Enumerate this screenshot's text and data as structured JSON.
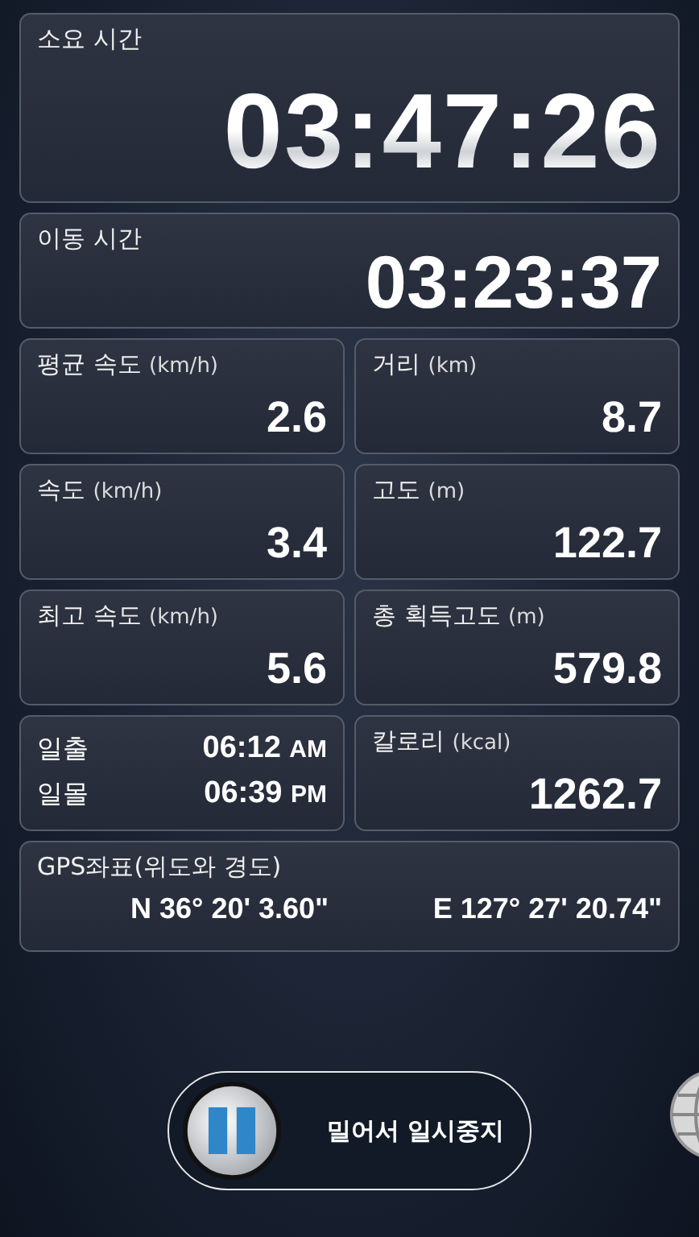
{
  "total_time": {
    "label": "소요 시간",
    "value": "03:47:26"
  },
  "moving_time": {
    "label": "이동 시간",
    "value": "03:23:37"
  },
  "tiles": [
    {
      "kind": "metric",
      "label": "평균 속도",
      "unit": "(km/h)",
      "value": "2.6"
    },
    {
      "kind": "metric",
      "label": "거리",
      "unit": "(km)",
      "value": "8.7"
    },
    {
      "kind": "metric",
      "label": "속도",
      "unit": "(km/h)",
      "value": "3.4"
    },
    {
      "kind": "metric",
      "label": "고도",
      "unit": "(m)",
      "value": "122.7"
    },
    {
      "kind": "metric",
      "label": "최고 속도",
      "unit": "(km/h)",
      "value": "5.6"
    },
    {
      "kind": "metric",
      "label": "총 획득고도",
      "unit": "(m)",
      "value": "579.8"
    },
    {
      "kind": "sun",
      "rows": [
        {
          "label": "일출",
          "time": "06:12",
          "suffix": "AM"
        },
        {
          "label": "일몰",
          "time": "06:39",
          "suffix": "PM"
        }
      ]
    },
    {
      "kind": "metric",
      "label": "칼로리",
      "unit": "(kcal)",
      "value": "1262.7"
    }
  ],
  "gps": {
    "label": "GPS좌표(위도와 경도)",
    "latitude": "N 36° 20' 3.60\"",
    "longitude": "E 127° 27' 20.74\""
  },
  "pause_slider": {
    "label": "밀어서 일시중지",
    "level": 0
  }
}
